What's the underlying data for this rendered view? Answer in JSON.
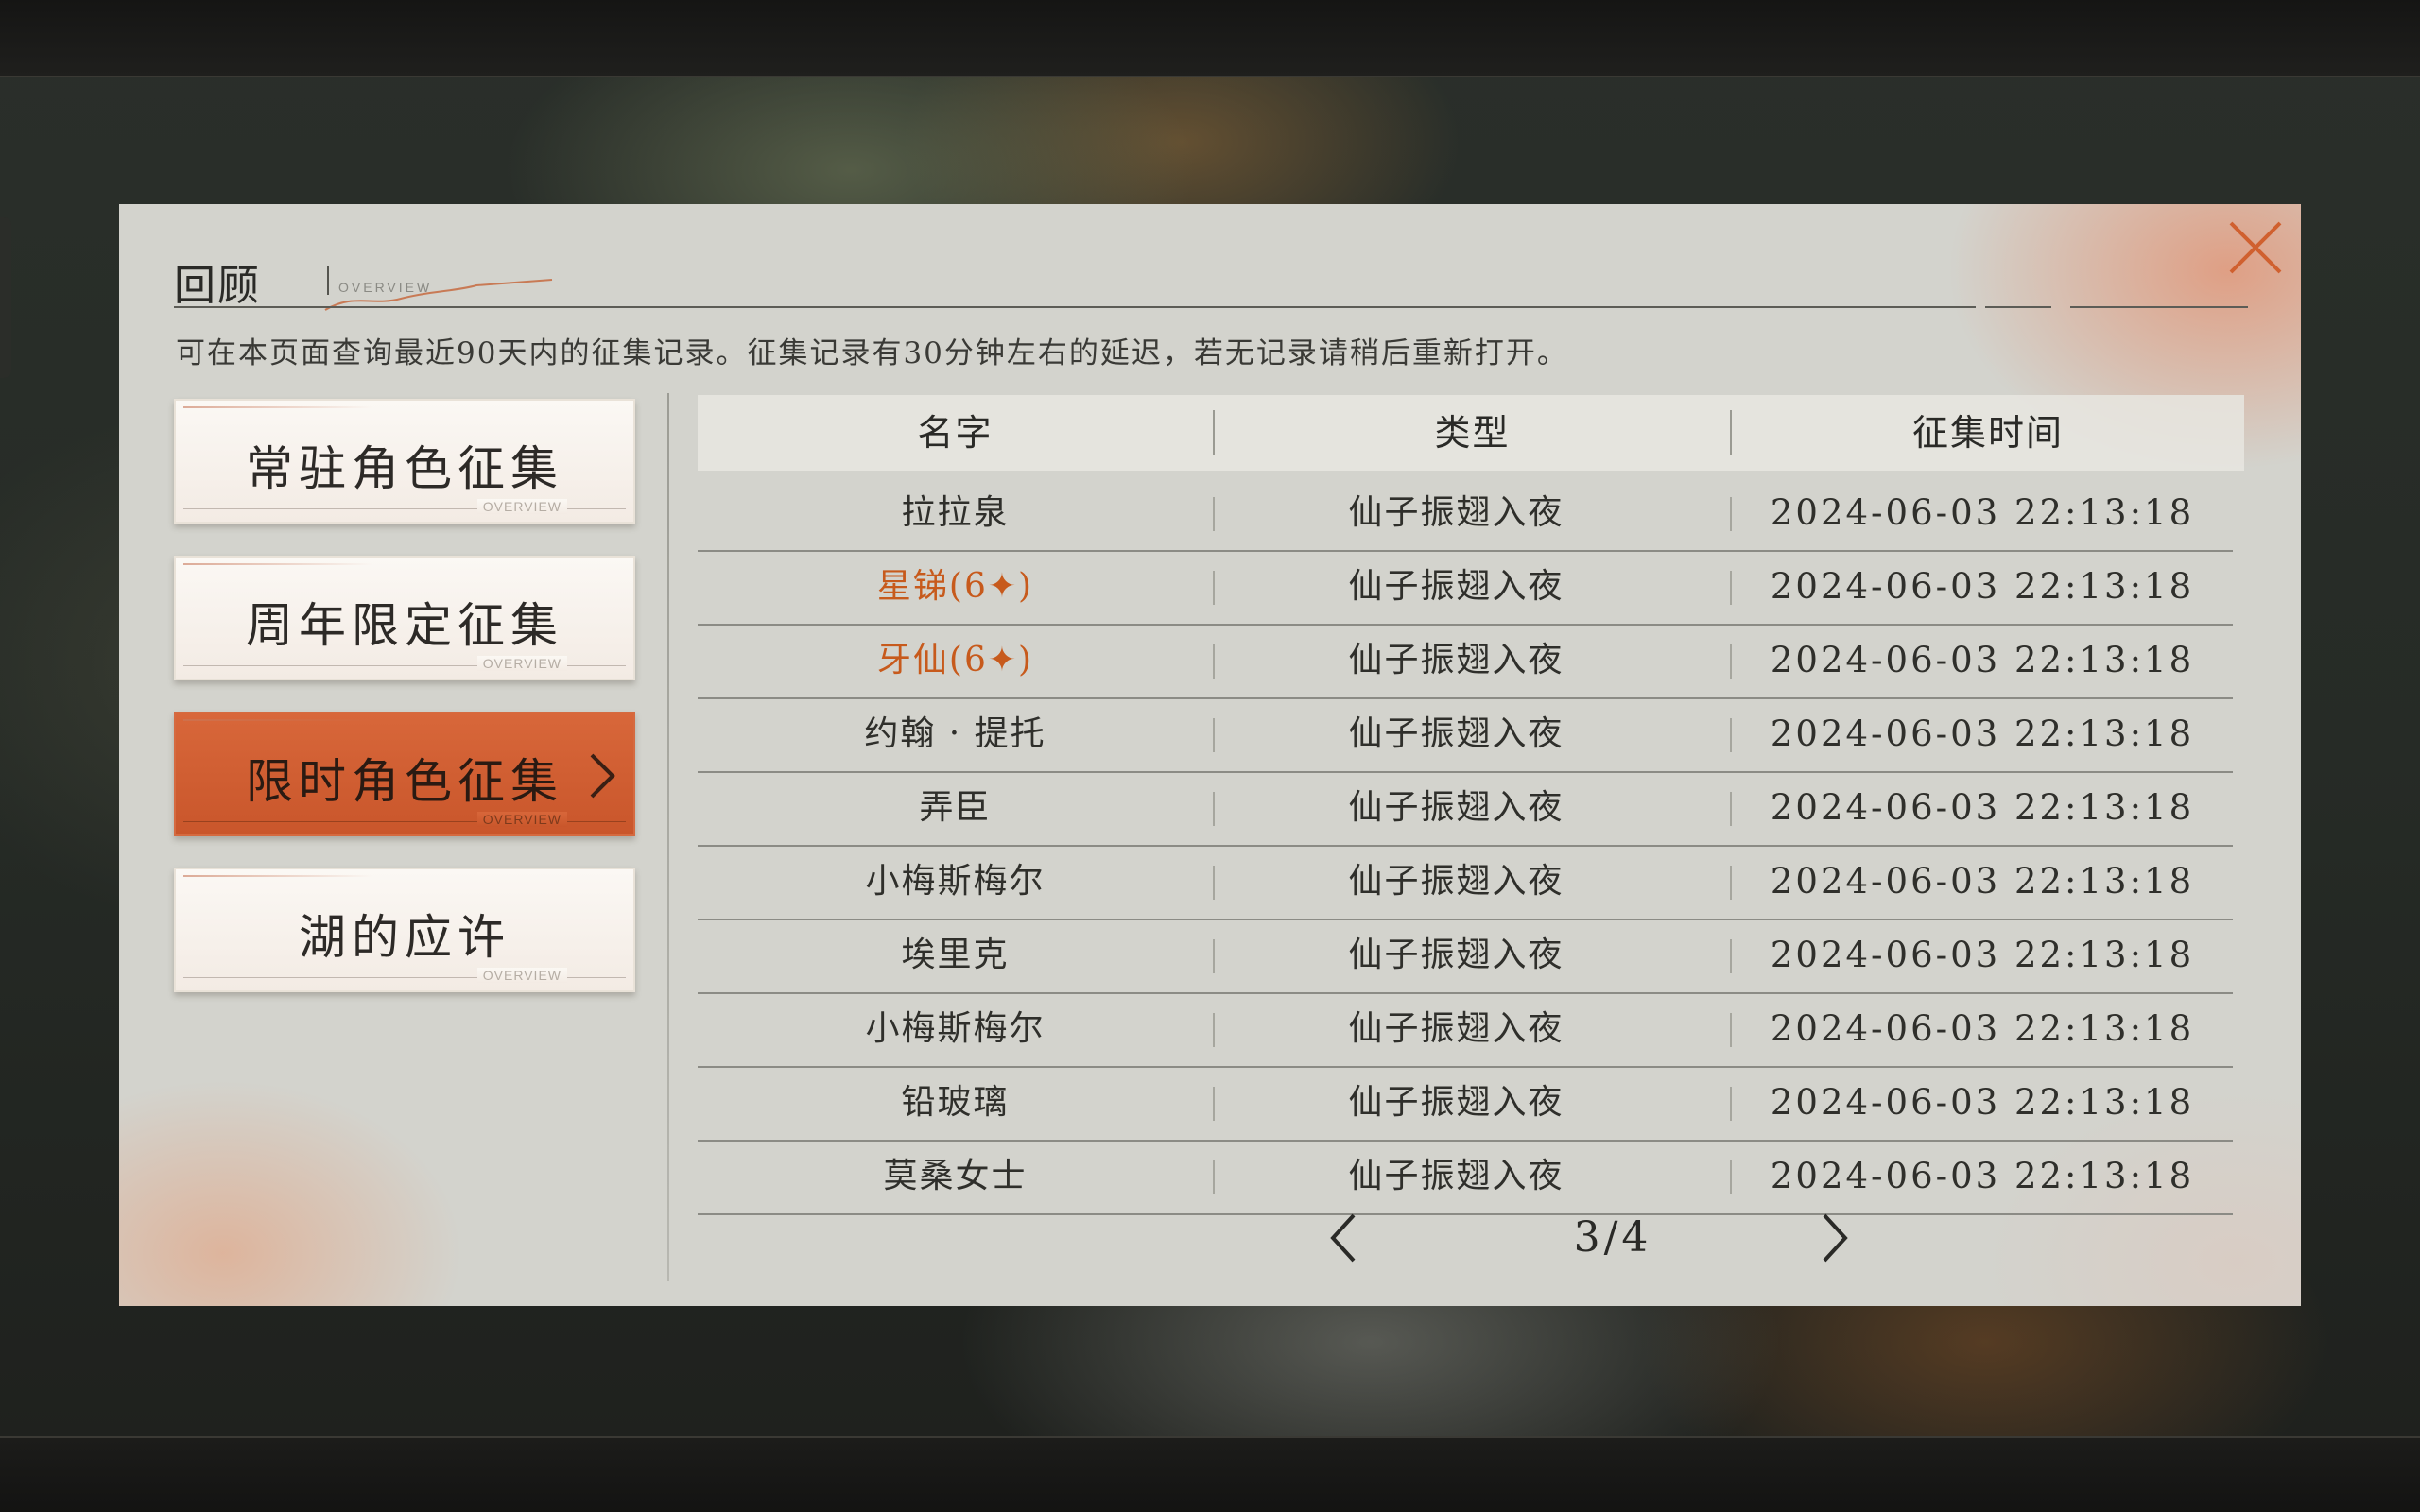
{
  "panel": {
    "title": "回顾",
    "title_sub": "OVERVIEW",
    "description": "可在本页面查询最近90天内的征集记录。征集记录有30分钟左右的延迟，若无记录请稍后重新打开。"
  },
  "categories": [
    {
      "label": "常驻角色征集",
      "deco": "OVERVIEW",
      "active": false
    },
    {
      "label": "周年限定征集",
      "deco": "OVERVIEW",
      "active": false
    },
    {
      "label": "限时角色征集",
      "deco": "OVERVIEW",
      "active": true
    },
    {
      "label": "湖的应许",
      "deco": "OVERVIEW",
      "active": false
    }
  ],
  "table": {
    "headers": [
      "名字",
      "类型",
      "征集时间"
    ],
    "rows": [
      {
        "name": "拉拉泉",
        "type": "仙子振翅入夜",
        "time": "2024-06-03 22:13:18",
        "rare": false
      },
      {
        "name": "星锑(6✦)",
        "type": "仙子振翅入夜",
        "time": "2024-06-03 22:13:18",
        "rare": true
      },
      {
        "name": "牙仙(6✦)",
        "type": "仙子振翅入夜",
        "time": "2024-06-03 22:13:18",
        "rare": true
      },
      {
        "name": "约翰 · 提托",
        "type": "仙子振翅入夜",
        "time": "2024-06-03 22:13:18",
        "rare": false
      },
      {
        "name": "弄臣",
        "type": "仙子振翅入夜",
        "time": "2024-06-03 22:13:18",
        "rare": false
      },
      {
        "name": "小梅斯梅尔",
        "type": "仙子振翅入夜",
        "time": "2024-06-03 22:13:18",
        "rare": false
      },
      {
        "name": "埃里克",
        "type": "仙子振翅入夜",
        "time": "2024-06-03 22:13:18",
        "rare": false
      },
      {
        "name": "小梅斯梅尔",
        "type": "仙子振翅入夜",
        "time": "2024-06-03 22:13:18",
        "rare": false
      },
      {
        "name": "铅玻璃",
        "type": "仙子振翅入夜",
        "time": "2024-06-03 22:13:18",
        "rare": false
      },
      {
        "name": "莫桑女士",
        "type": "仙子振翅入夜",
        "time": "2024-06-03 22:13:18",
        "rare": false
      }
    ]
  },
  "pager": {
    "text": "3/4"
  },
  "colors": {
    "accent": "#d0602f",
    "rare_text": "#c75a1c",
    "panel_bg": "#d3d3cd"
  },
  "icons": {
    "close": "close-icon",
    "prev": "chevron-left-icon",
    "next": "chevron-right-icon",
    "active_chevron": "chevron-right-icon"
  }
}
